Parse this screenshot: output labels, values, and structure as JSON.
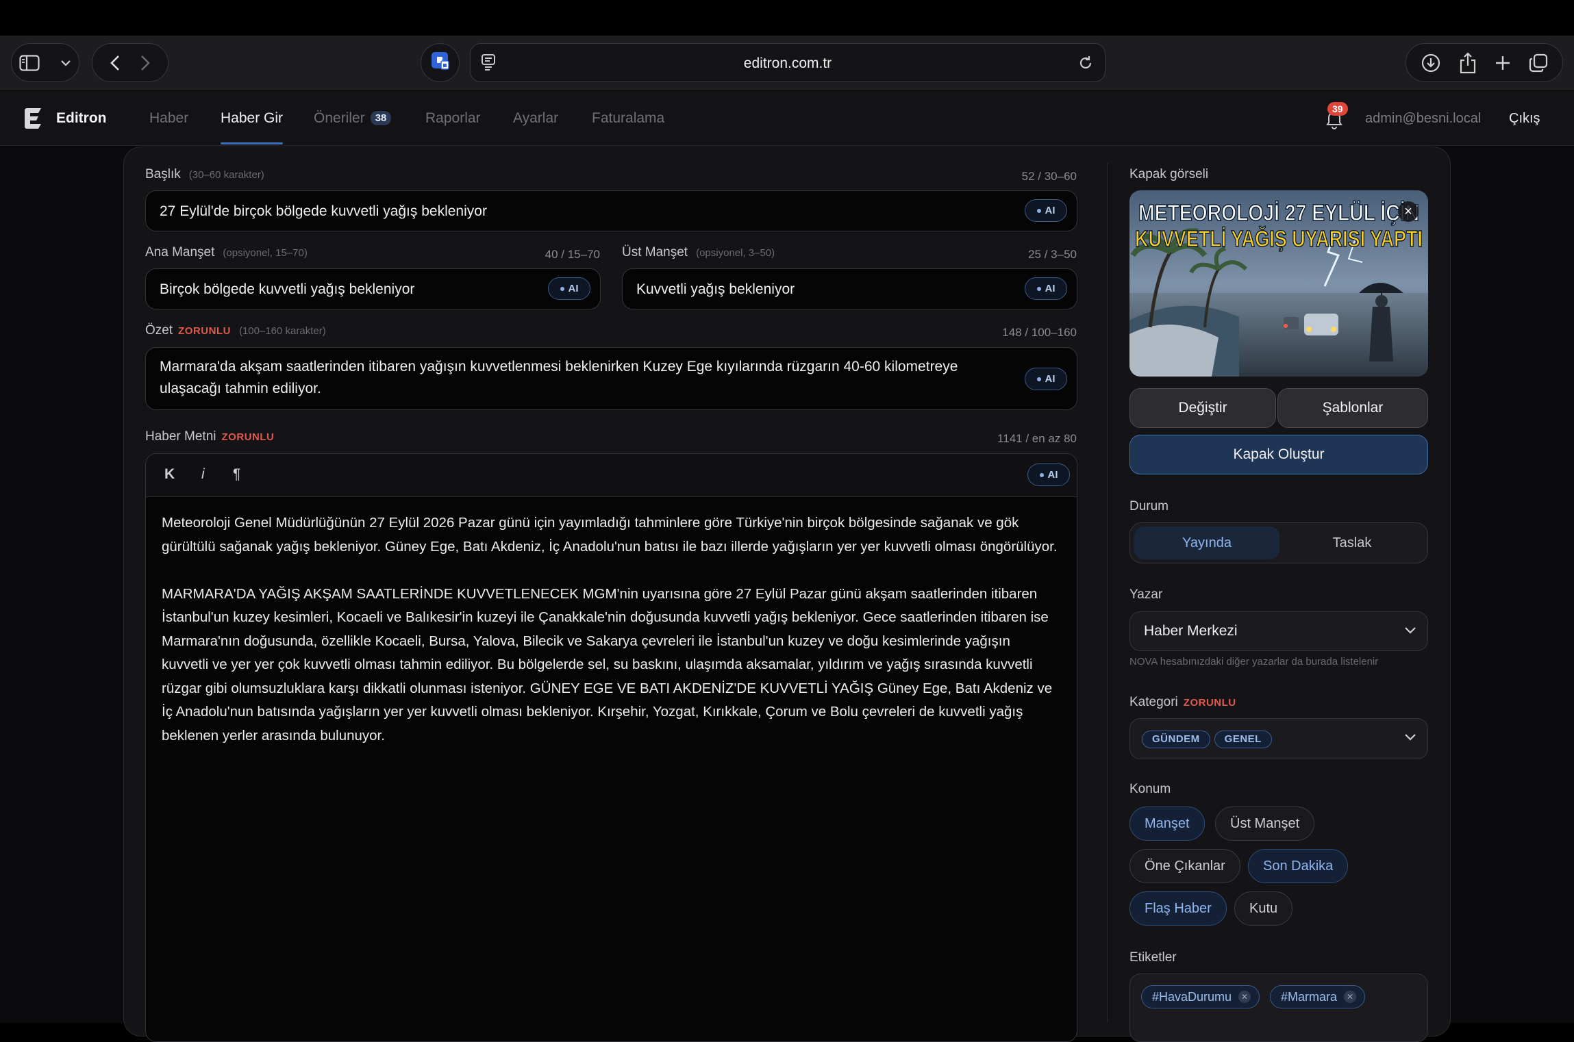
{
  "browser": {
    "url": "editron.com.tr"
  },
  "app": {
    "brand": "Editron",
    "nav": [
      {
        "label": "Haber",
        "active": false
      },
      {
        "label": "Haber Gir",
        "active": true
      },
      {
        "label": "Öneriler",
        "badge": "38",
        "active": false
      },
      {
        "label": "Raporlar",
        "active": false
      },
      {
        "label": "Ayarlar",
        "active": false
      },
      {
        "label": "Faturalama",
        "active": false
      }
    ],
    "notifications": "39",
    "user": "admin@besni.local",
    "logout": "Çıkış"
  },
  "form": {
    "ai_label": "AI",
    "required_label": "ZORUNLU",
    "title": {
      "label": "Başlık",
      "hint": "(30–60 karakter)",
      "count": "52 / 30–60",
      "value": "27 Eylül'de birçok bölgede kuvvetli yağış bekleniyor"
    },
    "main_headline": {
      "label": "Ana Manşet",
      "hint": "(opsiyonel, 15–70)",
      "count": "40 / 15–70",
      "value": "Birçok bölgede kuvvetli yağış bekleniyor"
    },
    "top_headline": {
      "label": "Üst Manşet",
      "hint": "(opsiyonel, 3–50)",
      "count": "25 / 3–50",
      "value": "Kuvvetli yağış bekleniyor"
    },
    "summary": {
      "label": "Özet",
      "hint": "(100–160 karakter)",
      "count": "148 / 100–160",
      "value": "Marmara'da akşam saatlerinden itibaren yağışın kuvvetlenmesi beklenirken Kuzey Ege kıyılarında rüzgarın 40-60 kilometreye ulaşacağı tahmin ediliyor."
    },
    "body": {
      "label": "Haber Metni",
      "count": "1141 / en az 80",
      "toolbar": {
        "bold": "K",
        "italic": "i",
        "paragraph": "¶"
      },
      "paragraphs": [
        "Meteoroloji Genel Müdürlüğünün 27 Eylül 2026 Pazar günü için yayımladığı tahminlere göre Türkiye'nin birçok bölgesinde sağanak ve gök gürültülü sağanak yağış bekleniyor. Güney Ege, Batı Akdeniz, İç Anadolu'nun batısı ile bazı illerde yağışların yer yer kuvvetli olması öngörülüyor.",
        "MARMARA'DA YAĞIŞ AKŞAM SAATLERİNDE KUVVETLENECEK MGM'nin uyarısına göre 27 Eylül Pazar günü akşam saatlerinden itibaren İstanbul'un kuzey kesimleri, Kocaeli ve Balıkesir'in kuzeyi ile Çanakkale'nin doğusunda kuvvetli yağış bekleniyor. Gece saatlerinden itibaren ise Marmara'nın doğusunda, özellikle Kocaeli, Bursa, Yalova, Bilecik ve Sakarya çevreleri ile İstanbul'un kuzey ve doğu kesimlerinde yağışın kuvvetli ve yer yer çok kuvvetli olması tahmin ediliyor. Bu bölgelerde sel, su baskını, ulaşımda aksamalar, yıldırım ve yağış sırasında kuvvetli rüzgar gibi olumsuzluklara karşı dikkatli olunması isteniyor. GÜNEY EGE VE BATI AKDENİZ'DE KUVVETLİ YAĞIŞ Güney Ege, Batı Akdeniz ve İç Anadolu'nun batısında yağışların yer yer kuvvetli olması bekleniyor. Kırşehir, Yozgat, Kırıkkale, Çorum ve Bolu çevreleri de kuvvetli yağış beklenen yerler arasında bulunuyor."
      ]
    }
  },
  "sidebar": {
    "cover": {
      "label": "Kapak görseli",
      "headline_line1": "METEOROLOJİ 27 EYLÜL İÇİN",
      "headline_line2": "KUVVETLİ YAĞIŞ UYARISI YAPTI",
      "change": "Değiştir",
      "templates": "Şablonlar",
      "create": "Kapak Oluştur"
    },
    "status": {
      "label": "Durum",
      "options": [
        "Yayında",
        "Taslak"
      ],
      "selected": "Yayında"
    },
    "author": {
      "label": "Yazar",
      "value": "Haber Merkezi",
      "help": "NOVA hesabınızdaki diğer yazarlar da burada listelenir"
    },
    "category": {
      "label": "Kategori",
      "chips": [
        "GÜNDEM",
        "GENEL"
      ]
    },
    "position": {
      "label": "Konum",
      "options": [
        {
          "label": "Manşet",
          "on": true
        },
        {
          "label": "Üst Manşet",
          "on": false
        },
        {
          "label": "Öne Çıkanlar",
          "on": false
        },
        {
          "label": "Son Dakika",
          "on": true
        },
        {
          "label": "Flaş Haber",
          "on": true
        },
        {
          "label": "Kutu",
          "on": false
        }
      ]
    },
    "tags": {
      "label": "Etiketler",
      "items": [
        "#HavaDurumu",
        "#Marmara"
      ]
    }
  },
  "colors": {
    "accent": "#3f6fb8",
    "required": "#e0594d",
    "badge": "#e0453a"
  }
}
